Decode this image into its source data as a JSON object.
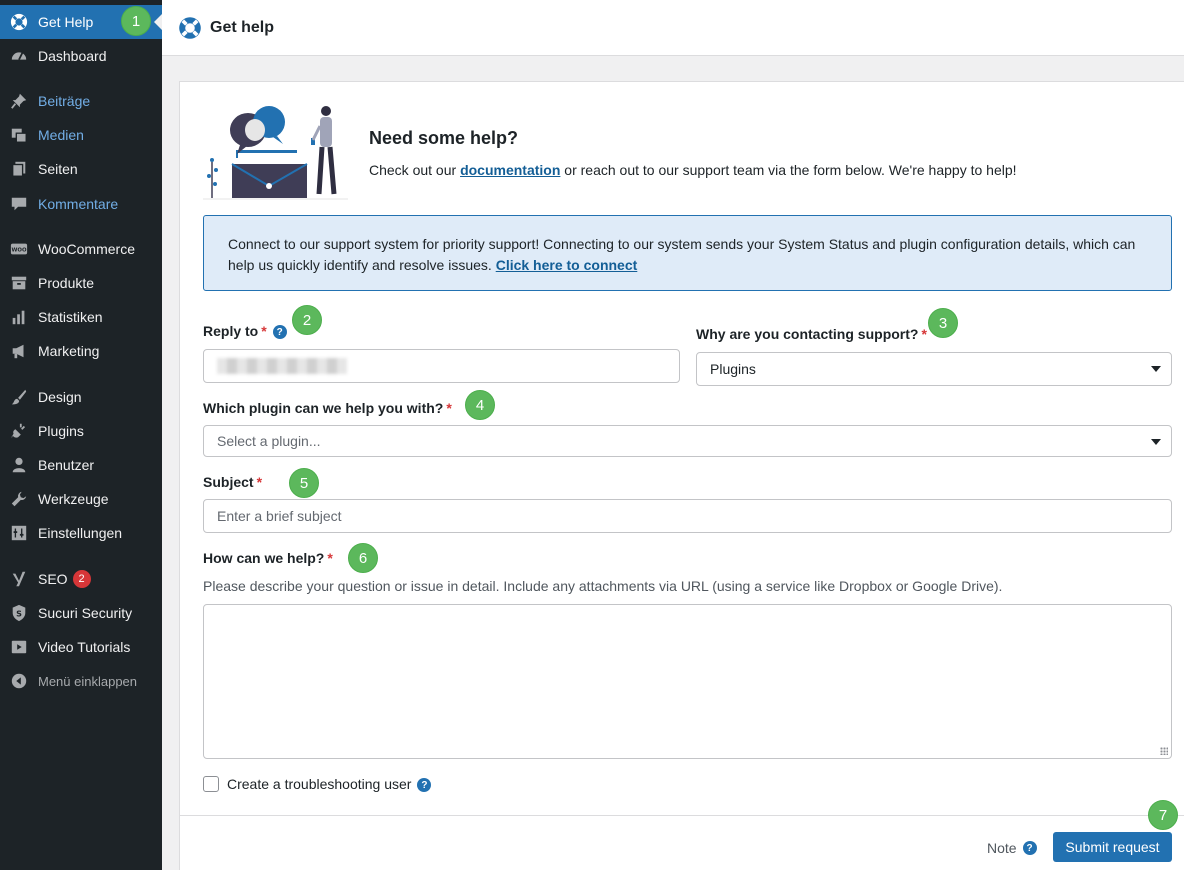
{
  "sidebar": {
    "items": [
      {
        "label": "Get Help",
        "icon": "lifebuoy-icon"
      },
      {
        "label": "Dashboard",
        "icon": "dashboard-icon"
      },
      {
        "label": "Beiträge",
        "icon": "pin-icon"
      },
      {
        "label": "Medien",
        "icon": "media-icon"
      },
      {
        "label": "Seiten",
        "icon": "pages-icon"
      },
      {
        "label": "Kommentare",
        "icon": "comment-icon"
      },
      {
        "label": "WooCommerce",
        "icon": "woo-icon"
      },
      {
        "label": "Produkte",
        "icon": "archive-icon"
      },
      {
        "label": "Statistiken",
        "icon": "chart-icon"
      },
      {
        "label": "Marketing",
        "icon": "megaphone-icon"
      },
      {
        "label": "Design",
        "icon": "brush-icon"
      },
      {
        "label": "Plugins",
        "icon": "plug-icon"
      },
      {
        "label": "Benutzer",
        "icon": "user-icon"
      },
      {
        "label": "Werkzeuge",
        "icon": "wrench-icon"
      },
      {
        "label": "Einstellungen",
        "icon": "settings-icon"
      },
      {
        "label": "SEO",
        "icon": "yoast-icon",
        "badge": "2"
      },
      {
        "label": "Sucuri Security",
        "icon": "shield-icon"
      },
      {
        "label": "Video Tutorials",
        "icon": "video-icon"
      },
      {
        "label": "Menü einklappen",
        "icon": "collapse-icon"
      }
    ],
    "woo_glyph": "WOO"
  },
  "header": {
    "title": "Get help",
    "icon": "lifebuoy-icon"
  },
  "intro": {
    "title": "Need some help?",
    "text_before": "Check out our ",
    "link": "documentation",
    "text_after": " or reach out to our support team via the form below. We're happy to help!"
  },
  "notice": {
    "text": "Connect to our support system for priority support! Connecting to our system sends your System Status and plugin configuration details, which can help us quickly identify and resolve issues. ",
    "link": "Click here to connect"
  },
  "form": {
    "reply_to": {
      "label": "Reply to",
      "required": "*",
      "help": "?"
    },
    "reason": {
      "label": "Why are you contacting support?",
      "required": "*",
      "value": "Plugins"
    },
    "plugin": {
      "label": "Which plugin can we help you with?",
      "required": "*",
      "placeholder": "Select a plugin..."
    },
    "subject": {
      "label": "Subject",
      "required": "*",
      "placeholder": "Enter a brief subject"
    },
    "message": {
      "label": "How can we help?",
      "required": "*",
      "description": "Please describe your question or issue in detail. Include any attachments via URL (using a service like Dropbox or Google Drive)."
    },
    "troubleshoot": {
      "label": "Create a troubleshooting user",
      "help": "?"
    }
  },
  "footer": {
    "note": "Note",
    "help": "?",
    "submit": "Submit request"
  },
  "steps": [
    "1",
    "2",
    "3",
    "4",
    "5",
    "6",
    "7"
  ],
  "colors": {
    "accent": "#2271b1",
    "sidebar": "#1d2327",
    "step": "#5cb85c",
    "required": "#d63638",
    "notice_bg": "#dfebf8"
  }
}
